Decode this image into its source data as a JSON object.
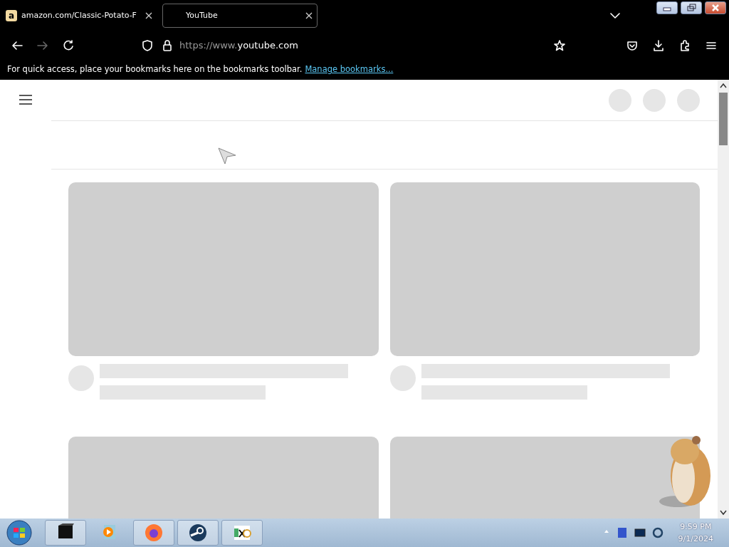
{
  "tabs": [
    {
      "label": "amazon.com/Classic-Potato-F",
      "selected": false,
      "favicon": "a"
    },
    {
      "label": "YouTube",
      "selected": true
    }
  ],
  "address_bar": {
    "url_prefix": "https://www.",
    "url_domain": "youtube.com"
  },
  "bookmarks_bar": {
    "message": "For quick access, place your bookmarks here on the bookmarks toolbar.",
    "link": "Manage bookmarks..."
  },
  "taskbar": {
    "time": "9:59 PM",
    "date": "9/1/2024"
  }
}
